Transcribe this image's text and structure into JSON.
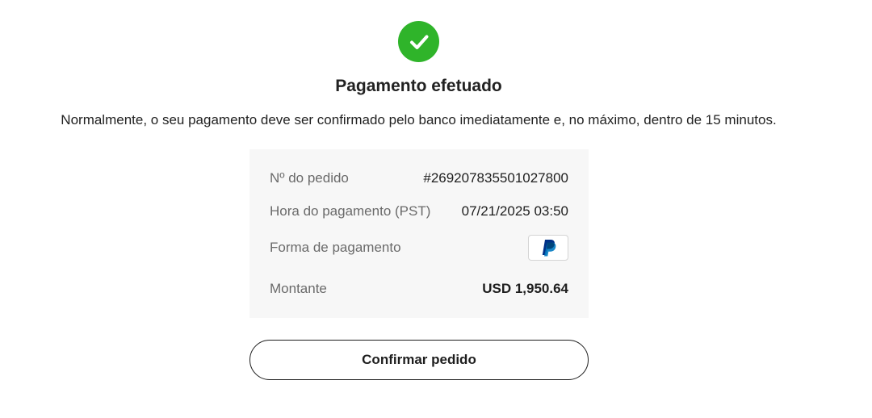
{
  "header": {
    "success_icon": "check-circle-icon",
    "success_color": "#2fb42a",
    "title": "Pagamento efetuado",
    "subtitle": "Normalmente, o seu pagamento deve ser confirmado pelo banco imediatamente e, no máximo, dentro de 15 minutos."
  },
  "details": {
    "order_label": "Nº do pedido",
    "order_value": "#269207835501027800",
    "time_label": "Hora do pagamento (PST)",
    "time_value": "07/21/2025 03:50",
    "method_label": "Forma de pagamento",
    "method_icon": "paypal-icon",
    "amount_label": "Montante",
    "amount_value": "USD 1,950.64"
  },
  "actions": {
    "confirm_label": "Confirmar pedido"
  }
}
